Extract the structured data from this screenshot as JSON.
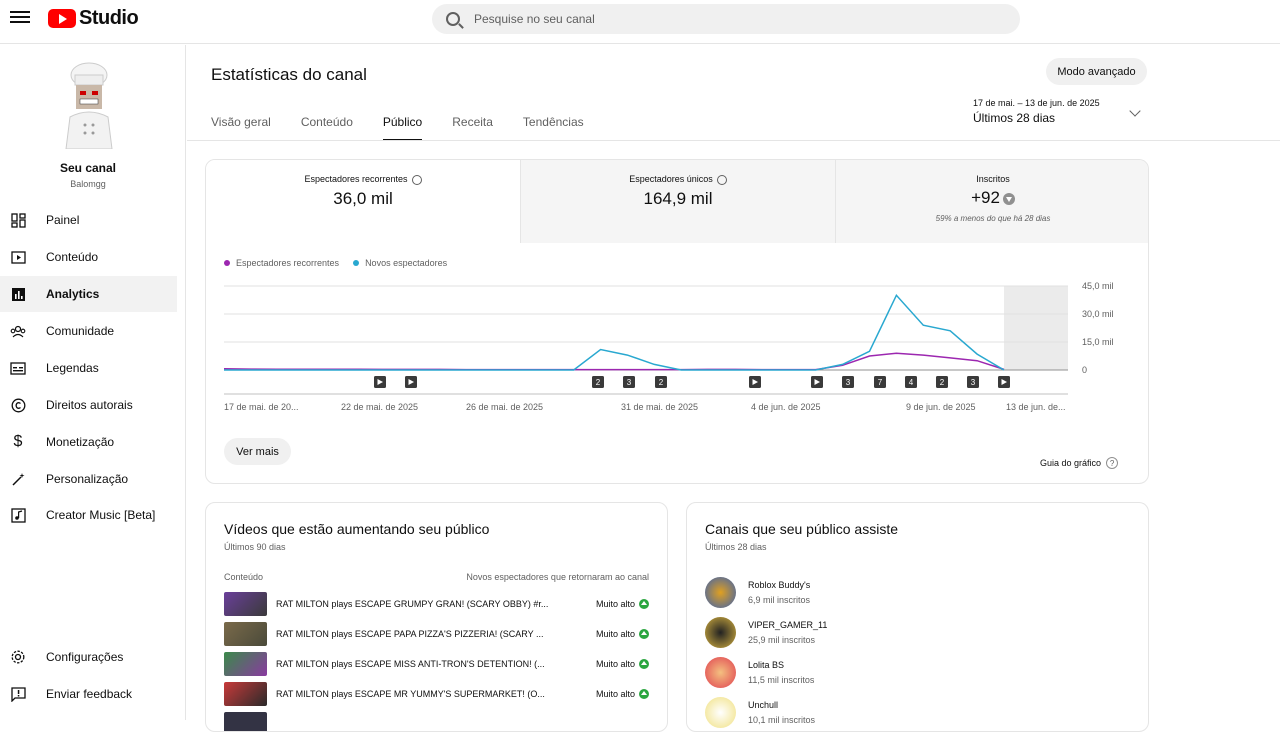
{
  "topbar": {
    "logo_text": "Studio",
    "search_placeholder": "Pesquise no seu canal"
  },
  "sidebar": {
    "channel_name": "Seu canal",
    "channel_handle": "Balomgg",
    "items": [
      {
        "label": "Painel",
        "icon": "dashboard-icon"
      },
      {
        "label": "Conteúdo",
        "icon": "content-icon"
      },
      {
        "label": "Analytics",
        "icon": "analytics-icon",
        "active": true
      },
      {
        "label": "Comunidade",
        "icon": "community-icon"
      },
      {
        "label": "Legendas",
        "icon": "subtitles-icon"
      },
      {
        "label": "Direitos autorais",
        "icon": "copyright-icon"
      },
      {
        "label": "Monetização",
        "icon": "dollar-icon"
      },
      {
        "label": "Personalização",
        "icon": "magic-wand-icon"
      },
      {
        "label": "Creator Music [Beta]",
        "icon": "music-icon"
      }
    ],
    "bottom_items": [
      {
        "label": "Configurações",
        "icon": "gear-icon"
      },
      {
        "label": "Enviar feedback",
        "icon": "feedback-icon"
      }
    ]
  },
  "header": {
    "title": "Estatísticas do canal",
    "advanced_button": "Modo avançado",
    "tabs": [
      "Visão geral",
      "Conteúdo",
      "Público",
      "Receita",
      "Tendências"
    ],
    "active_tab": "Público",
    "date_range": "17 de mai. – 13 de jun. de 2025",
    "date_label": "Últimos 28 dias"
  },
  "metrics": [
    {
      "label": "Espectadores recorrentes",
      "value": "36,0 mil"
    },
    {
      "label": "Espectadores únicos",
      "value": "164,9 mil"
    },
    {
      "label": "Inscritos",
      "value": "+92",
      "sub": "59% a menos do que há 28 dias"
    }
  ],
  "chart_data": {
    "type": "line",
    "series": [
      {
        "name": "Espectadores recorrentes",
        "color": "#9c27b0",
        "values": [
          700,
          500,
          400,
          400,
          400,
          400,
          300,
          300,
          300,
          200,
          200,
          200,
          200,
          200,
          200,
          200,
          200,
          200,
          300,
          300,
          200,
          200,
          200,
          2500,
          7500,
          9000,
          8000,
          6500,
          5000,
          300
        ]
      },
      {
        "name": "Novos espectadores",
        "color": "#29a8d0",
        "values": [
          0,
          0,
          0,
          0,
          0,
          0,
          0,
          0,
          0,
          0,
          0,
          0,
          0,
          0,
          11000,
          8000,
          3000,
          0,
          0,
          0,
          0,
          0,
          0,
          3000,
          10000,
          40000,
          24000,
          21000,
          8500,
          0
        ]
      }
    ],
    "x_ticks": [
      "17 de mai. de 20...",
      "22 de mai. de 2025",
      "26 de mai. de 2025",
      "31 de mai. de 2025",
      "4 de jun. de 2025",
      "9 de jun. de 2025",
      "13 de jun. de..."
    ],
    "y_ticks": [
      "45,0 mil",
      "30,0 mil",
      "15,0 mil",
      "0"
    ],
    "ylim": [
      0,
      45000
    ],
    "markers": [
      "▶",
      "▶",
      "2",
      "3",
      "2",
      "▶",
      "▶",
      "3",
      "7",
      "4",
      "2",
      "3",
      "▶"
    ]
  },
  "chart_card": {
    "more_button": "Ver mais",
    "guide_link": "Guia do gráfico"
  },
  "videos_card": {
    "title": "Vídeos que estão aumentando seu público",
    "subtitle": "Últimos 90 dias",
    "col_left": "Conteúdo",
    "col_right": "Novos espectadores que retornaram ao canal",
    "rows": [
      {
        "title": "RAT MILTON plays ESCAPE GRUMPY GRAN! (SCARY OBBY) #r...",
        "level": "Muito alto",
        "thumb": "#6a3f9a"
      },
      {
        "title": "RAT MILTON plays ESCAPE PAPA PIZZA'S PIZZERIA! (SCARY ...",
        "level": "Muito alto",
        "thumb": "#7a6a4a"
      },
      {
        "title": "RAT MILTON plays ESCAPE MISS ANTI-TRON'S DETENTION! (...",
        "level": "Muito alto",
        "thumb": "#3a8a4a"
      },
      {
        "title": "RAT MILTON plays ESCAPE MR YUMMY'S SUPERMARKET! (O...",
        "level": "Muito alto",
        "thumb": "#c83a3a"
      }
    ]
  },
  "channels_card": {
    "title": "Canais que seu público assiste",
    "subtitle": "Últimos 28 dias",
    "rows": [
      {
        "name": "Roblox Buddy's",
        "subs": "6,9 mil inscritos",
        "color": "#e0a020"
      },
      {
        "name": "VIPER_GAMER_11",
        "subs": "25,9 mil inscritos",
        "color": "#d4b040"
      },
      {
        "name": "Lolita BS",
        "subs": "11,5 mil inscritos",
        "color": "#e04050"
      },
      {
        "name": "Unchull",
        "subs": "10,1 mil inscritos",
        "color": "#f0e080"
      }
    ]
  }
}
